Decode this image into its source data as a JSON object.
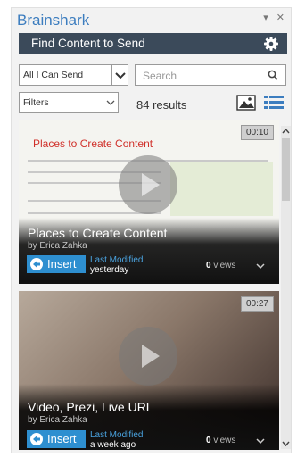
{
  "app": {
    "title": "Brainshark",
    "pane_controls": "▾ ✕"
  },
  "header": {
    "title": "Find Content to Send"
  },
  "filters": {
    "scope_value": "All I Can Send",
    "filters_value": "Filters",
    "search_placeholder": "Search",
    "results_text": "84 results"
  },
  "cards": [
    {
      "duration": "00:10",
      "thumb_title": "Places to Create Content",
      "title": "Places to Create Content",
      "author": "by Erica Zahka",
      "insert_label": "Insert",
      "modified_label": "Last Modified",
      "modified_value": "yesterday",
      "views_count": "0",
      "views_label": "views"
    },
    {
      "duration": "00:27",
      "title": "Video, Prezi, Live URL",
      "author": "by Erica Zahka",
      "insert_label": "Insert",
      "modified_label": "Last Modified",
      "modified_value": "a week ago",
      "views_count": "0",
      "views_label": "views"
    }
  ],
  "colors": {
    "brand": "#3c7dbf",
    "header_bg": "#3b4a5a",
    "insert_btn": "#2e8fd0",
    "modified_label": "#4aa3e0",
    "thumb_title": "#d0302a"
  },
  "icons": [
    "gear-icon",
    "chevron-down-icon",
    "search-icon",
    "image-view-icon",
    "list-view-icon",
    "play-icon",
    "insert-arrow-icon"
  ]
}
